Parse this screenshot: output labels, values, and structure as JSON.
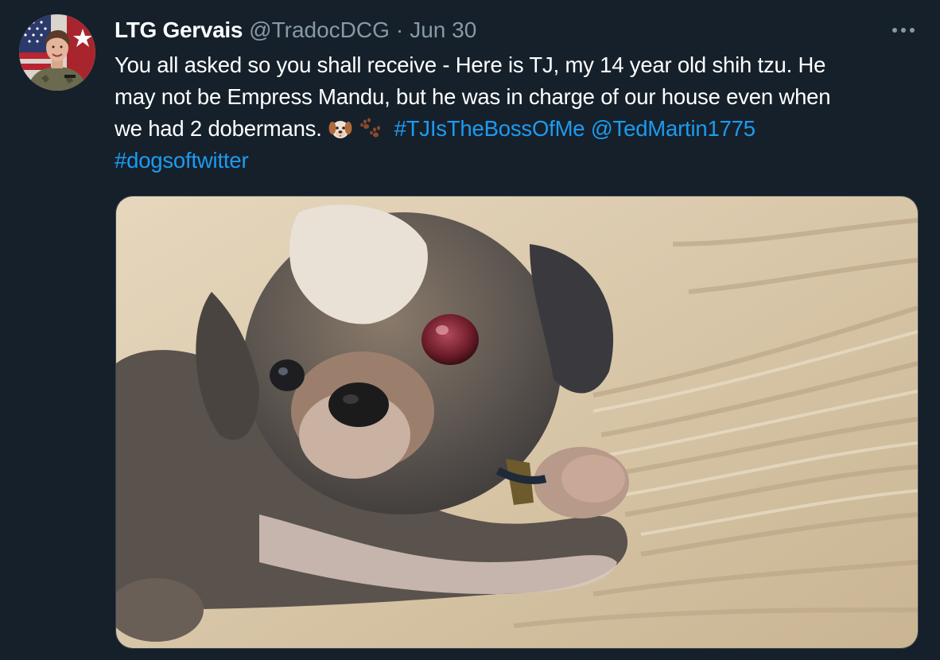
{
  "tweet": {
    "author": {
      "display_name": "LTG Gervais",
      "handle": "@TradocDCG",
      "avatar": "profile-photo"
    },
    "separator": "·",
    "date": "Jun 30",
    "more_icon": "more-horizontal-icon",
    "text": {
      "line1": "You all asked so you shall receive - Here is TJ, my 14 year old shih tzu. He",
      "line2": "may not be Empress Mandu, but he was in charge of our house even when",
      "line3_prefix": "we had 2 dobermans.",
      "emojis": [
        "dog-face-emoji",
        "paw-prints-emoji"
      ],
      "hashtag1": "#TJIsTheBossOfMe",
      "mention": "@TedMartin1775",
      "hashtag2": "#dogsoftwitter"
    },
    "media": {
      "type": "photo",
      "subject": "shih-tzu-on-blanket"
    }
  },
  "colors": {
    "background": "#15202b",
    "text": "#ffffff",
    "secondary_text": "#8899a6",
    "link": "#1d9bf0",
    "border": "#38444d"
  }
}
